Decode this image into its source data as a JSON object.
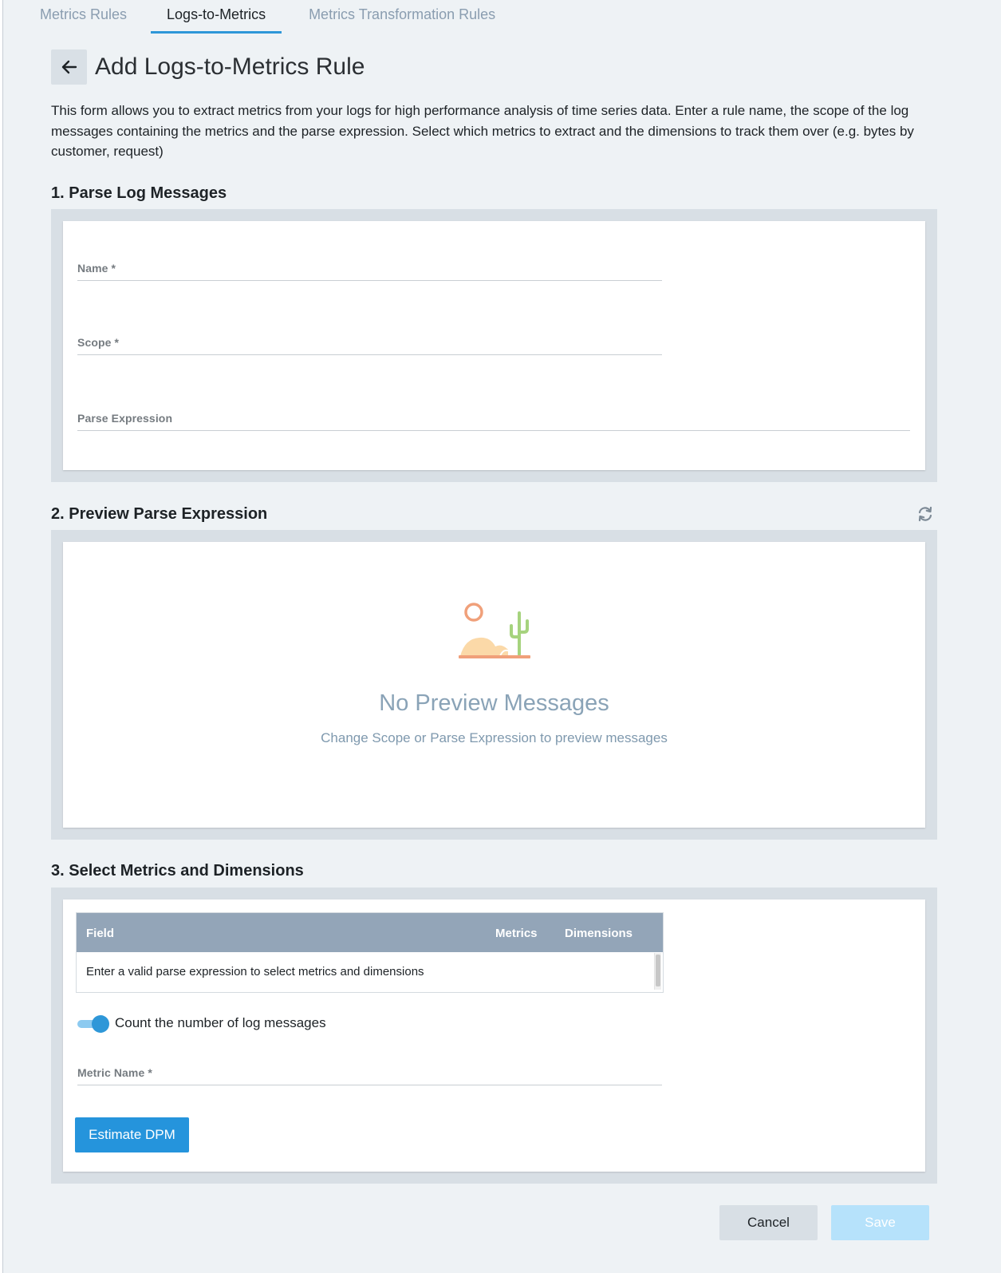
{
  "tabs": [
    {
      "label": "Metrics Rules"
    },
    {
      "label": "Logs-to-Metrics"
    },
    {
      "label": "Metrics Transformation Rules"
    }
  ],
  "active_tab": "Logs-to-Metrics",
  "header": {
    "back_icon": "arrow-left-icon",
    "title": "Add Logs-to-Metrics Rule"
  },
  "description": "This form allows you to extract metrics from your logs for high performance analysis of time series data. Enter a rule name, the scope of the log messages containing the metrics and the parse expression. Select which metrics to extract and the dimensions to track them over (e.g. bytes by customer, request)",
  "section1": {
    "title": "1. Parse Log Messages",
    "name_label": "Name *",
    "name_value": "",
    "scope_label": "Scope *",
    "scope_value": "",
    "parse_label": "Parse Expression",
    "parse_value": ""
  },
  "section2": {
    "title": "2. Preview Parse Expression",
    "refresh_icon": "refresh-icon",
    "empty_title": "No Preview Messages",
    "empty_subtitle": "Change Scope or Parse Expression to preview messages",
    "illustration": "desert-cactus-illustration"
  },
  "section3": {
    "title": "3. Select Metrics and Dimensions",
    "table": {
      "columns": [
        "Field",
        "Metrics",
        "Dimensions"
      ],
      "rows": [
        "Enter a valid parse expression to select metrics and dimensions"
      ]
    },
    "toggle_on": true,
    "toggle_label": "Count the number of log messages",
    "metric_name_label": "Metric Name *",
    "metric_name_value": "",
    "estimate_button": "Estimate DPM"
  },
  "footer": {
    "cancel_label": "Cancel",
    "save_label": "Save"
  },
  "colors": {
    "accent": "#2594dc",
    "background": "#eef2f5",
    "table_header": "#93a5b8",
    "save_disabled": "#b6e2fb"
  }
}
